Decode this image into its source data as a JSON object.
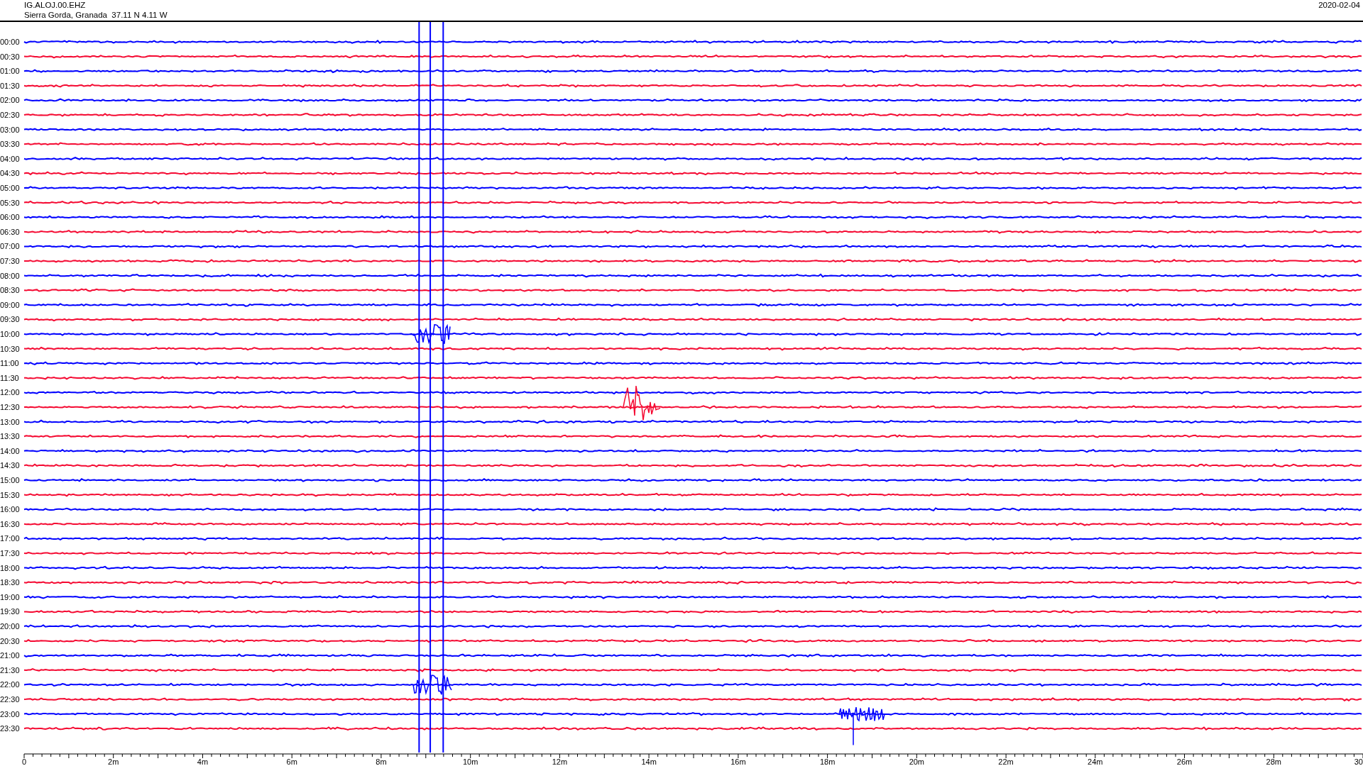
{
  "header": {
    "station": "IG.ALOJ.00.EHZ",
    "location": "Sierra Gorda, Granada  37.11 N 4.11 W",
    "date": "2020-02-04"
  },
  "rows": [
    {
      "label": "00:00",
      "color": "#0000ff"
    },
    {
      "label": "00:30",
      "color": "#f50a32"
    },
    {
      "label": "01:00",
      "color": "#0000ff"
    },
    {
      "label": "01:30",
      "color": "#f50a32"
    },
    {
      "label": "02:00",
      "color": "#0000ff"
    },
    {
      "label": "02:30",
      "color": "#f50a32"
    },
    {
      "label": "03:00",
      "color": "#0000ff"
    },
    {
      "label": "03:30",
      "color": "#f50a32"
    },
    {
      "label": "04:00",
      "color": "#0000ff"
    },
    {
      "label": "04:30",
      "color": "#f50a32"
    },
    {
      "label": "05:00",
      "color": "#0000ff"
    },
    {
      "label": "05:30",
      "color": "#f50a32"
    },
    {
      "label": "06:00",
      "color": "#0000ff"
    },
    {
      "label": "06:30",
      "color": "#f50a32"
    },
    {
      "label": "07:00",
      "color": "#0000ff"
    },
    {
      "label": "07:30",
      "color": "#f50a32"
    },
    {
      "label": "08:00",
      "color": "#0000ff"
    },
    {
      "label": "08:30",
      "color": "#f50a32"
    },
    {
      "label": "09:00",
      "color": "#0000ff"
    },
    {
      "label": "09:30",
      "color": "#f50a32"
    },
    {
      "label": "10:00",
      "color": "#0000ff"
    },
    {
      "label": "10:30",
      "color": "#f50a32"
    },
    {
      "label": "11:00",
      "color": "#0000ff"
    },
    {
      "label": "11:30",
      "color": "#f50a32"
    },
    {
      "label": "12:00",
      "color": "#0000ff"
    },
    {
      "label": "12:30",
      "color": "#f50a32"
    },
    {
      "label": "13:00",
      "color": "#0000ff"
    },
    {
      "label": "13:30",
      "color": "#f50a32"
    },
    {
      "label": "14:00",
      "color": "#0000ff"
    },
    {
      "label": "14:30",
      "color": "#f50a32"
    },
    {
      "label": "15:00",
      "color": "#0000ff"
    },
    {
      "label": "15:30",
      "color": "#f50a32"
    },
    {
      "label": "16:00",
      "color": "#0000ff"
    },
    {
      "label": "16:30",
      "color": "#f50a32"
    },
    {
      "label": "17:00",
      "color": "#0000ff"
    },
    {
      "label": "17:30",
      "color": "#f50a32"
    },
    {
      "label": "18:00",
      "color": "#0000ff"
    },
    {
      "label": "18:30",
      "color": "#f50a32"
    },
    {
      "label": "19:00",
      "color": "#0000ff"
    },
    {
      "label": "19:30",
      "color": "#f50a32"
    },
    {
      "label": "20:00",
      "color": "#0000ff"
    },
    {
      "label": "20:30",
      "color": "#f50a32"
    },
    {
      "label": "21:00",
      "color": "#0000ff"
    },
    {
      "label": "21:30",
      "color": "#f50a32"
    },
    {
      "label": "22:00",
      "color": "#0000ff"
    },
    {
      "label": "22:30",
      "color": "#f50a32"
    },
    {
      "label": "23:00",
      "color": "#0000ff"
    },
    {
      "label": "23:30",
      "color": "#f50a32"
    }
  ],
  "axis_labels": [
    "0",
    "2m",
    "4m",
    "6m",
    "8m",
    "10m",
    "12m",
    "14m",
    "16m",
    "18m",
    "20m",
    "22m",
    "24m",
    "26m",
    "28m",
    "30"
  ]
}
